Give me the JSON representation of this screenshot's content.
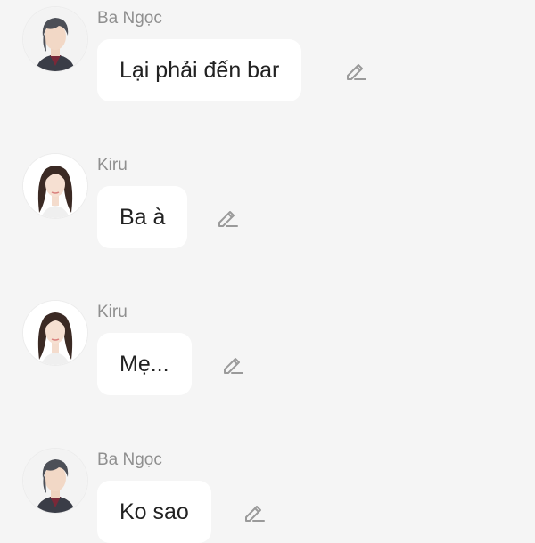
{
  "messages": [
    {
      "sender": "Ba Ngọc",
      "avatar_icon": "man-avatar-icon",
      "text": "Lại phải đến bar"
    },
    {
      "sender": "Kiru",
      "avatar_icon": "woman-avatar-icon",
      "text": "Ba à"
    },
    {
      "sender": "Kiru",
      "avatar_icon": "woman-avatar-icon",
      "text": "Mẹ..."
    },
    {
      "sender": "Ba Ngọc",
      "avatar_icon": "man-avatar-icon",
      "text": "Ko sao"
    }
  ],
  "actions": {
    "edit_icon": "pencil-edit-icon"
  },
  "colors": {
    "background": "#f5f5f5",
    "bubble": "#ffffff",
    "sender_name": "#8f8f8f",
    "message_text": "#222222",
    "edit_icon": "#9a9a9a"
  }
}
